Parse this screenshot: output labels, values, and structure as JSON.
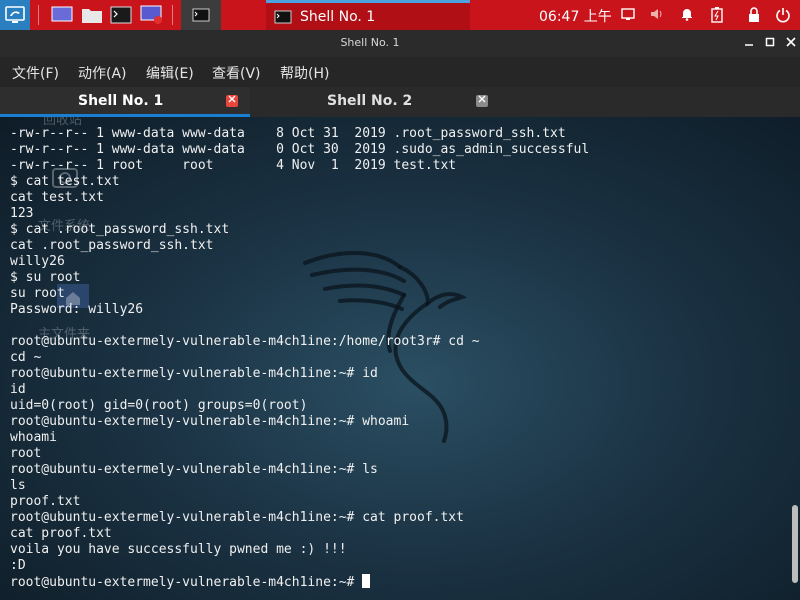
{
  "panel": {
    "clock": "06:47 上午",
    "shell_task_label": "Shell No. 1"
  },
  "window": {
    "title": "Shell No. 1"
  },
  "menu": {
    "items": [
      "文件(F)",
      "动作(A)",
      "编辑(E)",
      "查看(V)",
      "帮助(H)"
    ]
  },
  "tabs": [
    {
      "label": "Shell No. 1",
      "active": true
    },
    {
      "label": "Shell No. 2",
      "active": false
    }
  ],
  "desktop_icons": [
    "回收站",
    "文件系统",
    "主文件夹"
  ],
  "terminal": {
    "lines": [
      "-rw-r--r-- 1 www-data www-data    8 Oct 31  2019 .root_password_ssh.txt",
      "-rw-r--r-- 1 www-data www-data    0 Oct 30  2019 .sudo_as_admin_successful",
      "-rw-r--r-- 1 root     root        4 Nov  1  2019 test.txt",
      "$ cat test.txt",
      "cat test.txt",
      "123",
      "$ cat .root_password_ssh.txt",
      "cat .root_password_ssh.txt",
      "willy26",
      "$ su root",
      "su root",
      "Password: willy26",
      "",
      "root@ubuntu-extermely-vulnerable-m4ch1ine:/home/root3r# cd ~",
      "cd ~",
      "root@ubuntu-extermely-vulnerable-m4ch1ine:~# id",
      "id",
      "uid=0(root) gid=0(root) groups=0(root)",
      "root@ubuntu-extermely-vulnerable-m4ch1ine:~# whoami",
      "whoami",
      "root",
      "root@ubuntu-extermely-vulnerable-m4ch1ine:~# ls",
      "ls",
      "proof.txt",
      "root@ubuntu-extermely-vulnerable-m4ch1ine:~# cat proof.txt",
      "cat proof.txt",
      "voila you have successfully pwned me :) !!!",
      ":D"
    ],
    "prompt": "root@ubuntu-extermely-vulnerable-m4ch1ine:~# "
  },
  "colors": {
    "panel_red": "#c9141c",
    "accent_blue": "#1b7fd1",
    "terminal_text": "#f0f0f0"
  }
}
